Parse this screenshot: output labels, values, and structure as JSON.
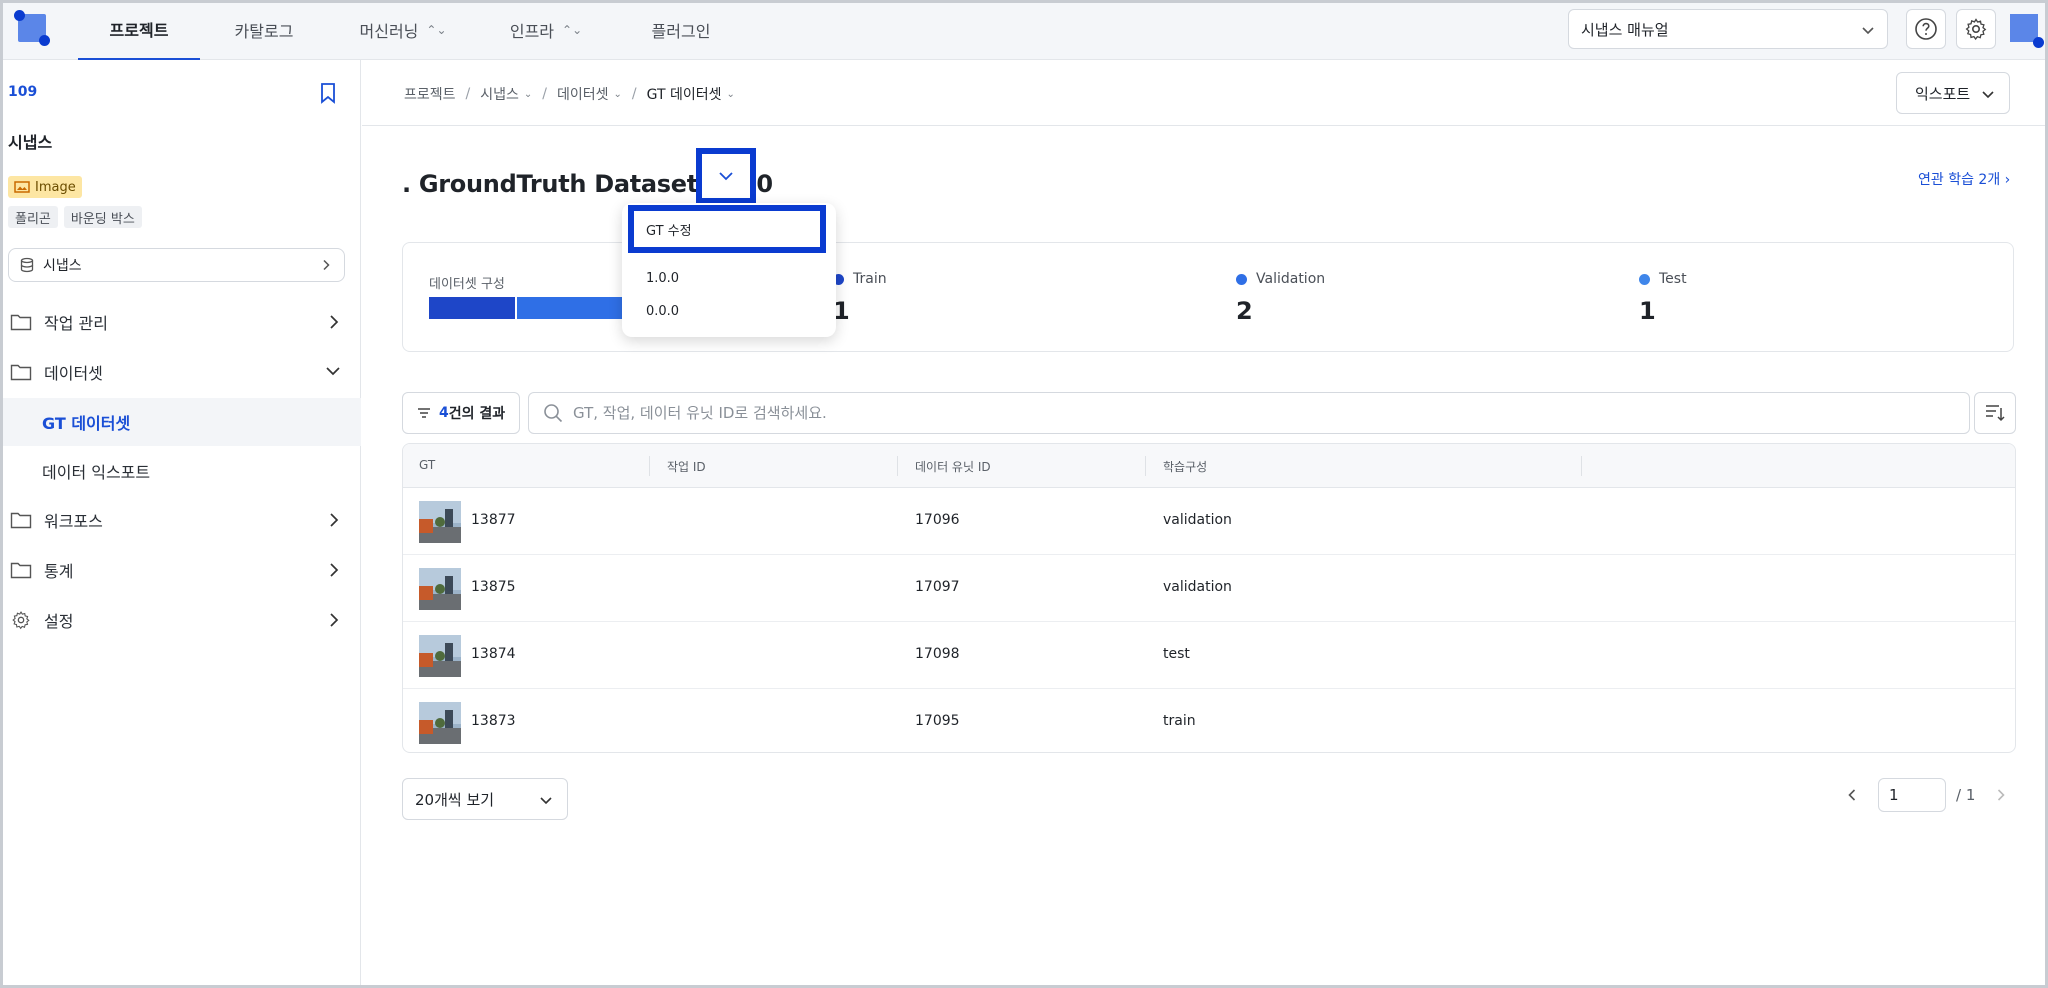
{
  "topnav": {
    "items": [
      {
        "label": "프로젝트",
        "active": true,
        "has_menu": false
      },
      {
        "label": "카탈로그",
        "active": false,
        "has_menu": false
      },
      {
        "label": "머신러닝",
        "active": false,
        "has_menu": true
      },
      {
        "label": "인프라",
        "active": false,
        "has_menu": true
      },
      {
        "label": "플러그인",
        "active": false,
        "has_menu": false
      }
    ],
    "manual_select": "시냅스 매뉴얼",
    "help_icon": "help-icon",
    "settings_icon": "gear-icon"
  },
  "sidebar": {
    "project_id": "109",
    "project_name": "시냅스",
    "media_badge": "Image",
    "tags": [
      "폴리곤",
      "바운딩 박스"
    ],
    "dataset_select": "시냅스",
    "items": {
      "jobs": "작업 관리",
      "datasets": "데이터셋",
      "gt_datasets": "GT 데이터셋",
      "data_export": "데이터 익스포트",
      "workforce": "워크포스",
      "stats": "통계",
      "settings": "설정"
    }
  },
  "breadcrumb": {
    "root": "프로젝트",
    "project": "시냅스",
    "section": "데이터셋",
    "current": "GT 데이터셋"
  },
  "export_label": "익스포트",
  "dataset_title": ". GroundTruth Dataset 1.0.0",
  "related_link": "연관 학습 2개",
  "stats": {
    "caption": "데이터셋 구성",
    "items": [
      {
        "label": "Train",
        "value": "1",
        "color": "#1e46c8"
      },
      {
        "label": "Validation",
        "value": "2",
        "color": "#2f6fe6"
      },
      {
        "label": "Test",
        "value": "1",
        "color": "#3f86ea"
      }
    ]
  },
  "filter": {
    "count": "4",
    "suffix": "건의 결과"
  },
  "search_placeholder": "GT, 작업, 데이터 유닛 ID로 검색하세요.",
  "table": {
    "columns": [
      "GT",
      "작업 ID",
      "데이터 유닛 ID",
      "학습구성"
    ],
    "rows": [
      {
        "gt": "13877",
        "job_id": "",
        "unit_id": "17096",
        "split": "validation"
      },
      {
        "gt": "13875",
        "job_id": "",
        "unit_id": "17097",
        "split": "validation"
      },
      {
        "gt": "13874",
        "job_id": "",
        "unit_id": "17098",
        "split": "test"
      },
      {
        "gt": "13873",
        "job_id": "",
        "unit_id": "17095",
        "split": "train"
      }
    ]
  },
  "page_size": "20개씩 보기",
  "pager": {
    "current": "1",
    "total": "/ 1"
  },
  "dropdown": {
    "edit_label": "GT 수정",
    "versions": [
      "1.0.0",
      "0.0.0"
    ]
  },
  "accent_color": "#1a4fd6",
  "highlight_color": "#0a3bd0"
}
